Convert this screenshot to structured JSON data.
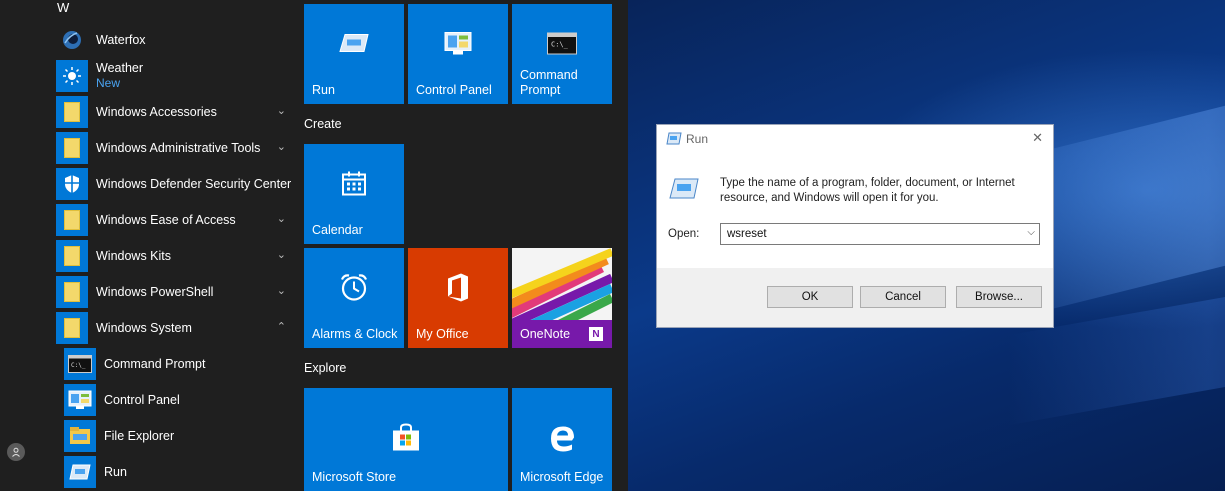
{
  "app_list": {
    "section_letter": "W",
    "items": [
      {
        "label": "Waterfox"
      },
      {
        "label": "Weather",
        "badge": "New"
      },
      {
        "label": "Windows Accessories"
      },
      {
        "label": "Windows Administrative Tools"
      },
      {
        "label": "Windows Defender Security Center"
      },
      {
        "label": "Windows Ease of Access"
      },
      {
        "label": "Windows Kits"
      },
      {
        "label": "Windows PowerShell"
      },
      {
        "label": "Windows System"
      }
    ],
    "subitems": [
      {
        "label": "Command Prompt"
      },
      {
        "label": "Control Panel"
      },
      {
        "label": "File Explorer"
      },
      {
        "label": "Run"
      }
    ]
  },
  "tiles": {
    "run": "Run",
    "control_panel": "Control Panel",
    "command_prompt": "Command Prompt",
    "group_create": "Create",
    "calendar": "Calendar",
    "alarms": "Alarms & Clock",
    "my_office": "My Office",
    "onenote": "OneNote",
    "group_explore": "Explore",
    "store": "Microsoft Store",
    "edge": "Microsoft Edge"
  },
  "run_dialog": {
    "title": "Run",
    "message": "Type the name of a program, folder, document, or Internet resource, and Windows will open it for you.",
    "open_label": "Open:",
    "open_value": "wsreset",
    "ok": "OK",
    "cancel": "Cancel",
    "browse": "Browse..."
  },
  "colors": {
    "accent": "#0078d7",
    "menu_bg": "#1f1f1f",
    "office": "#d83b01",
    "onenote": "#7719aa"
  }
}
